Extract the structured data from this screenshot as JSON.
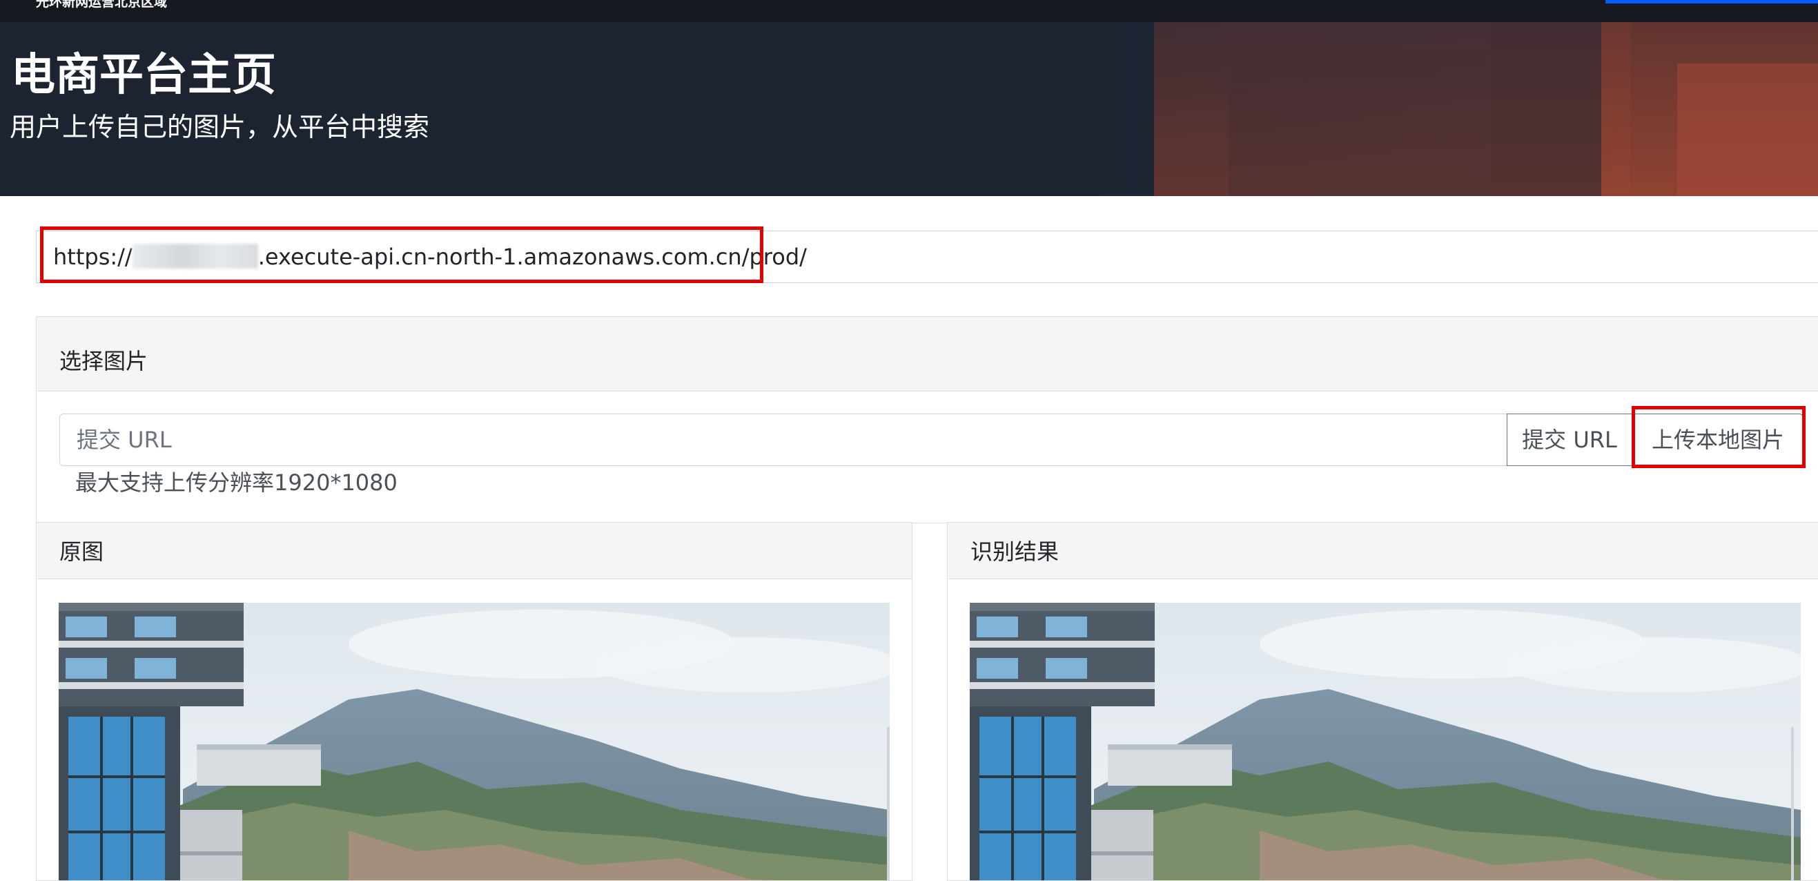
{
  "topbar": {
    "text": "光环新网运营北京区域"
  },
  "hero": {
    "title": "电商平台主页",
    "subtitle": "用户上传自己的图片，从平台中搜索"
  },
  "api": {
    "prefix": "https://",
    "suffix": ".execute-api.cn-north-1.amazonaws.com.cn/prod/"
  },
  "select_card": {
    "header": "选择图片",
    "url_placeholder": "提交 URL",
    "submit_label": "提交 URL",
    "upload_label": "上传本地图片",
    "help": "最大支持上传分辨率1920*1080"
  },
  "panels": {
    "original": {
      "header": "原图"
    },
    "result": {
      "header": "识别结果"
    }
  },
  "colors": {
    "highlight": "#e00000",
    "hero_bg": "#1c2432",
    "topbar_bg": "#16191f",
    "accent": "#0a5bff"
  }
}
